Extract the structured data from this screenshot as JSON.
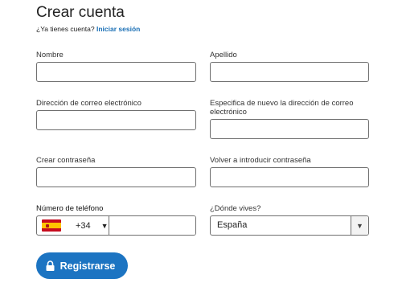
{
  "header": {
    "title": "Crear cuenta",
    "have_account": "¿Ya tienes cuenta?",
    "signin_link": "Iniciar sesión"
  },
  "form": {
    "first_name": {
      "label": "Nombre",
      "value": ""
    },
    "last_name": {
      "label": "Apellido",
      "value": ""
    },
    "email": {
      "label": "Dirección de correo electrónico",
      "value": ""
    },
    "email_confirm": {
      "label": "Especifica de nuevo la dirección de correo electrónico",
      "value": ""
    },
    "password": {
      "label": "Crear contraseña",
      "value": ""
    },
    "password_confirm": {
      "label": "Volver a introducir contraseña",
      "value": ""
    },
    "phone": {
      "label": "Número de teléfono",
      "country_icon": "spain-flag-icon",
      "dial_code": "+34",
      "value": ""
    },
    "country": {
      "label": "¿Dónde vives?",
      "selected": "España"
    }
  },
  "submit": {
    "label": "Registrarse",
    "icon": "lock-icon",
    "color": "#1c74c2"
  },
  "colors": {
    "link": "#1a6fb5",
    "border": "#6f6f6f"
  }
}
